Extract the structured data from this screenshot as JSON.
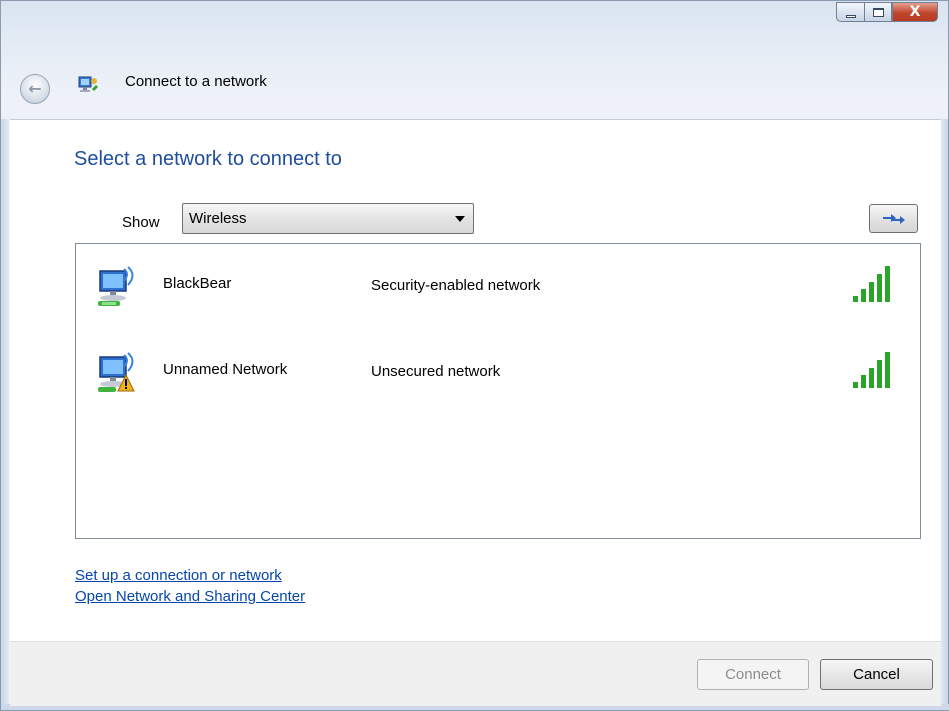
{
  "window": {
    "title": "Connect to a network",
    "controls": {
      "minimize": "minimize",
      "maximize": "maximize",
      "close": "X"
    }
  },
  "heading": "Select a network to connect to",
  "filter": {
    "label": "Show",
    "value": "Wireless"
  },
  "networks": [
    {
      "name": "BlackBear",
      "security": "Security-enabled network",
      "signal_bars": 5,
      "signal_max": 5,
      "icon": "wireless-network-secure-icon"
    },
    {
      "name": "Unnamed Network",
      "security": "Unsecured network",
      "signal_bars": 5,
      "signal_max": 5,
      "icon": "wireless-network-unsecured-icon"
    }
  ],
  "links": {
    "setup": "Set up a connection or network",
    "sharing_center": "Open Network and Sharing Center"
  },
  "buttons": {
    "connect": "Connect",
    "cancel": "Cancel"
  },
  "colors": {
    "heading": "#1e4d9d",
    "link": "#0645ad",
    "signal": "#2aa52a",
    "close": "#c1462e"
  }
}
